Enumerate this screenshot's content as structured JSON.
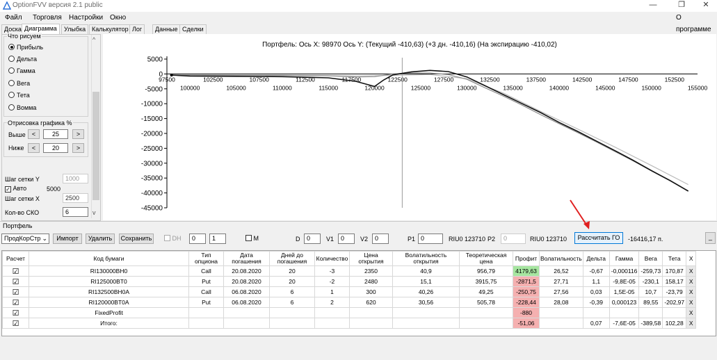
{
  "window": {
    "title": "OptionFVV версия 2.1 public"
  },
  "menu": [
    "Файл",
    "Торговля",
    "Настройки",
    "Окно"
  ],
  "about": "О программе",
  "tabs": [
    "Доска",
    "Диаграмма",
    "Улыбка",
    "Калькулятор",
    "Лог",
    "Данные",
    "Сделки"
  ],
  "left": {
    "group_title": "Что рисуем",
    "radios": [
      {
        "label": "Прибыль",
        "checked": true
      },
      {
        "label": "Дельта",
        "checked": false
      },
      {
        "label": "Гамма",
        "checked": false
      },
      {
        "label": "Вега",
        "checked": false
      },
      {
        "label": "Тета",
        "checked": false
      },
      {
        "label": "Вомма",
        "checked": false
      }
    ],
    "draw_title": "Отрисовка графика %",
    "above_label": "Выше",
    "above_value": "25",
    "below_label": "Ниже",
    "below_value": "20",
    "minus": "<",
    "plus": ">",
    "grid_y_label": "Шаг сетки Y",
    "grid_y_value": "1000",
    "auto_label": "Авто",
    "auto_value": "5000",
    "grid_x_label": "Шаг сетки X",
    "grid_x_value": "2500",
    "sko_label": "Кол-во СКО",
    "sko_value": "6"
  },
  "chart_data": {
    "type": "line",
    "title": "Портфель: Ось X: 98970 Ось Y:  (Текущий -410,63)  (+3 дн. -410,16)  (На экспирацию -410,02)",
    "x_ticks_top": [
      "97500",
      "102500",
      "107500",
      "112500",
      "117500",
      "122500",
      "127500",
      "132500",
      "137500",
      "142500",
      "147500",
      "152500"
    ],
    "x_ticks_bottom": [
      "100000",
      "105000",
      "110000",
      "115000",
      "120000",
      "125000",
      "130000",
      "135000",
      "140000",
      "145000",
      "150000",
      "155000"
    ],
    "y_ticks": [
      "5000",
      "0",
      "-5000",
      "-10000",
      "-15000",
      "-20000",
      "-25000",
      "-30000",
      "-35000",
      "-40000",
      "-45000"
    ],
    "xlim": [
      97500,
      155000
    ],
    "ylim": [
      -45000,
      5000
    ],
    "cursor_x": 123000,
    "series": [
      {
        "color": "#111111",
        "x": [
          98000,
          100000,
          105000,
          110000,
          115000,
          118000,
          120000,
          121000,
          122000,
          124000,
          126000,
          128000,
          130000,
          132000,
          134000,
          136000,
          138000,
          140000,
          142000,
          144000,
          146000,
          148000,
          150000,
          152000,
          154000
        ],
        "y": [
          -400,
          -700,
          -800,
          -900,
          -1300,
          -2500,
          -4200,
          -2000,
          -300,
          700,
          1200,
          800,
          -1000,
          -4000,
          -7000,
          -10000,
          -13000,
          -16300,
          -19300,
          -22500,
          -25700,
          -29000,
          -32500,
          -35800,
          -39400
        ]
      },
      {
        "color": "#888888",
        "x": [
          98000,
          105000,
          110000,
          115000,
          118000,
          120000,
          122000,
          124000,
          126000,
          128000,
          130000,
          132000,
          134000,
          136000,
          138000,
          140000,
          142000,
          144000,
          146000,
          148000,
          150000,
          152000,
          154000
        ],
        "y": [
          -400,
          -500,
          -500,
          -600,
          -1000,
          -900,
          0,
          300,
          300,
          -200,
          -1800,
          -4700,
          -7500,
          -10500,
          -13700,
          -16700,
          -19700,
          -22800,
          -26000,
          -29200,
          -32600,
          -35900,
          -39400
        ]
      },
      {
        "color": "#bbbbbb",
        "x": [
          98000,
          105000,
          112000,
          118000,
          122000,
          126000,
          130000,
          134000,
          138000,
          142000,
          146000,
          150000,
          154000
        ],
        "y": [
          -400,
          -450,
          -500,
          -650,
          -500,
          -200,
          -1600,
          -6500,
          -12600,
          -18500,
          -24500,
          -30800,
          -37200
        ]
      }
    ]
  },
  "portfolio": {
    "label": "Портфель",
    "select": "ПродКорСтр",
    "import": "Импорт",
    "delete": "Удалить",
    "save": "Сохранить",
    "dh_label": "DH",
    "spin1": "0",
    "spin2": "1",
    "m_label": "M",
    "d_label": "D",
    "d_value": "0",
    "v1_label": "V1",
    "v1_value": "0",
    "v2_label": "V2",
    "v2_value": "0",
    "p1_label": "P1",
    "p1_value": "0",
    "riu_text1": "RIU0 123710",
    "p2_label": "P2",
    "p2_value": "0",
    "riu_text2": "RIU0 123710",
    "calc_button": "Рассчитать ГО",
    "go_value": "-16416,17 п.",
    "minimize": "_"
  },
  "table": {
    "headers": [
      "Расчет",
      "Код бумаги",
      "Тип опциона",
      "Дата погашения",
      "Дней до погашения",
      "Количество",
      "Цена открытия",
      "Волатильность открытия",
      "Теоретическая цена",
      "Профит",
      "Волатильность",
      "Дельта",
      "Гамма",
      "Вега",
      "Тета",
      "X"
    ],
    "rows": [
      {
        "check": "☑",
        "code": "RI130000BH0",
        "type": "Call",
        "date": "20.08.2020",
        "days": "20",
        "qty": "-3",
        "price": "2350",
        "vol_open": "40,9",
        "theo": "956,79",
        "profit": "4179,63",
        "profit_class": "green",
        "vol": "26,52",
        "delta": "-0,67",
        "gamma": "-0,000116",
        "vega": "-259,73",
        "theta": "170,87",
        "x": "X"
      },
      {
        "check": "☑",
        "code": "RI125000BT0",
        "type": "Put",
        "date": "20.08.2020",
        "days": "20",
        "qty": "-2",
        "price": "2480",
        "vol_open": "15,1",
        "theo": "3915,75",
        "profit": "-2871,5",
        "profit_class": "red",
        "vol": "27,71",
        "delta": "1,1",
        "gamma": "-9,8E-05",
        "vega": "-230,1",
        "theta": "158,17",
        "x": "X"
      },
      {
        "check": "☑",
        "code": "RI132500BH0A",
        "type": "Call",
        "date": "06.08.2020",
        "days": "6",
        "qty": "1",
        "price": "300",
        "vol_open": "40,26",
        "theo": "49,25",
        "profit": "-250,75",
        "profit_class": "red",
        "vol": "27,56",
        "delta": "0,03",
        "gamma": "1,5E-05",
        "vega": "10,7",
        "theta": "-23,79",
        "x": "X"
      },
      {
        "check": "☑",
        "code": "RI120000BT0A",
        "type": "Put",
        "date": "06.08.2020",
        "days": "6",
        "qty": "2",
        "price": "620",
        "vol_open": "30,56",
        "theo": "505,78",
        "profit": "-228,44",
        "profit_class": "red",
        "vol": "28,08",
        "delta": "-0,39",
        "gamma": "0,000123",
        "vega": "89,55",
        "theta": "-202,97",
        "x": "X"
      },
      {
        "check": "☑",
        "code": "FixedProfit",
        "type": "",
        "date": "",
        "days": "",
        "qty": "",
        "price": "",
        "vol_open": "",
        "theo": "",
        "profit": "-880",
        "profit_class": "red",
        "vol": "",
        "delta": "",
        "gamma": "",
        "vega": "",
        "theta": "",
        "x": "X"
      },
      {
        "check": "☑",
        "code": "Итого:",
        "type": "",
        "date": "",
        "days": "",
        "qty": "",
        "price": "",
        "vol_open": "",
        "theo": "",
        "profit": "-51,06",
        "profit_class": "red",
        "vol": "",
        "delta": "0,07",
        "gamma": "-7,6E-05",
        "vega": "-389,58",
        "theta": "102,28",
        "x": "X"
      }
    ]
  },
  "colors": {
    "arrow": "#e02020",
    "profit_green": "#a6e6a0",
    "profit_red": "#f5b0b0"
  }
}
